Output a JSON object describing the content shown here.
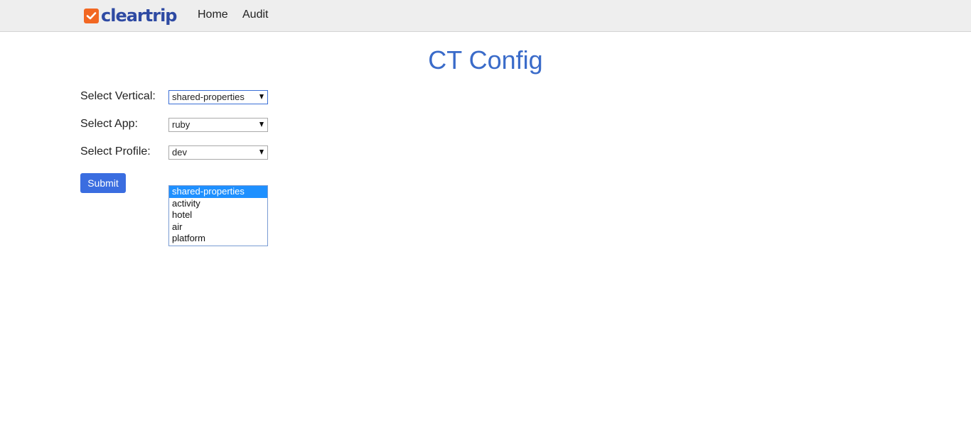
{
  "brand": {
    "logo_text": "cleartrip",
    "logo_icon": "check-mark-icon",
    "logo_color": "#f26722",
    "text_color": "#2e4aa3"
  },
  "nav": {
    "items": [
      {
        "label": "Home"
      },
      {
        "label": "Audit"
      }
    ]
  },
  "page": {
    "title": "CT Config",
    "title_color": "#3a6bc9"
  },
  "form": {
    "vertical": {
      "label": "Select Vertical:",
      "value": "shared-properties"
    },
    "app": {
      "label": "Select App:",
      "value": "ruby"
    },
    "profile": {
      "label": "Select Profile:",
      "value": "dev"
    },
    "submit_label": "Submit",
    "submit_color": "#3a6de0"
  },
  "vertical_dropdown": {
    "open": true,
    "options": [
      "shared-properties",
      "activity",
      "hotel",
      "air",
      "platform"
    ],
    "selected": "shared-properties",
    "highlight_color": "#1e90ff"
  }
}
